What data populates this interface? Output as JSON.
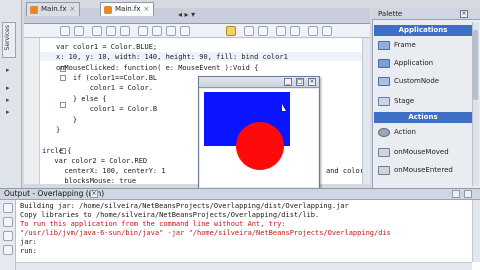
{
  "left_strip": {
    "services_label": "Services"
  },
  "editor_tabs": [
    {
      "label": "Main.fx",
      "active": false
    },
    {
      "label": "Main.fx",
      "active": true
    }
  ],
  "editor_tab_close": "×",
  "code_lines": [
    "var color1 = Color.BLUE;",
    "x: 10, y: 10, width: 140, height: 90, fill: bind color1",
    "onMouseClicked: function( e: MouseEvent ):Void {",
    "    if (color1==Color.BL",
    "        color1 = Color.",
    "    } else {",
    "        color1 = Color.B",
    "    }",
    "}",
    "",
    "ircle {",
    "  var color2 = Color.RED",
    "  centerX: 100, centerY: 1",
    "  blocksMouse: true"
  ],
  "code_line_tail_right": "and color",
  "palette": {
    "title": "Palette",
    "sections": [
      {
        "title": "Applications",
        "items": [
          "Frame",
          "Application",
          "CustomNode",
          "Stage"
        ]
      },
      {
        "title": "Actions",
        "items": [
          "Action",
          "onMouseMoved",
          "onMouseEntered"
        ]
      }
    ]
  },
  "app_window": {
    "buttons": [
      "_",
      "□",
      "×"
    ]
  },
  "output": {
    "title": "Output - Overlapping (run)",
    "close": "×",
    "lines": [
      {
        "text": "Building jar: /home/silveira/NetBeansProjects/Overlapping/dist/Overlapping.jar",
        "error": false
      },
      {
        "text": "Copy libraries to /home/silveira/NetBeansProjects/Overlapping/dist/lib.",
        "error": false
      },
      {
        "text": "To run this application from the command line without Ant, try:",
        "error": true
      },
      {
        "text": "\"/usr/lib/jvm/java-6-sun/bin/java\" -jar \"/home/silveira/NetBeansProjects/Overlapping/dis",
        "error": true
      },
      {
        "text": "jar:",
        "error": false
      },
      {
        "text": "run:",
        "error": false
      }
    ]
  },
  "colors": {
    "rect_fill": "#0a14ff",
    "circle_fill": "#ff0a0a",
    "palette_section": "#3e6fc4"
  }
}
